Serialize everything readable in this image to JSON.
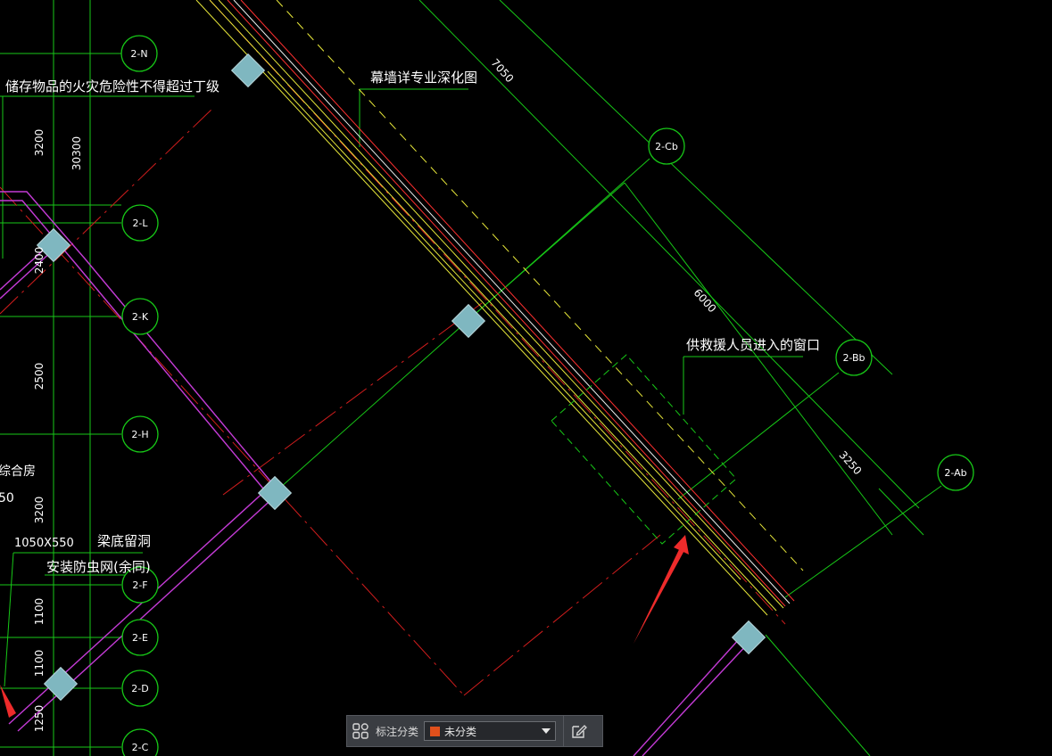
{
  "axes": [
    {
      "label": "2-N"
    },
    {
      "label": "2-L"
    },
    {
      "label": "2-K"
    },
    {
      "label": "2-H"
    },
    {
      "label": "2-F"
    },
    {
      "label": "2-E"
    },
    {
      "label": "2-D"
    },
    {
      "label": "2-C"
    },
    {
      "label": "2-Cb"
    },
    {
      "label": "2-Bb"
    },
    {
      "label": "2-Ab"
    }
  ],
  "dimensions_vertical": [
    "3200",
    "30300",
    "2400",
    "2500",
    "3200",
    "1100",
    "1100",
    "1250"
  ],
  "dimensions_diagonal": [
    "7050",
    "6000",
    "3250"
  ],
  "annotations": {
    "fire_rating": "储存物品的火灾危险性不得超过丁级",
    "curtain_wall": "幕墙详专业深化图",
    "rescue_window": "供救援人员进入的窗口",
    "room_partial": "综合房",
    "size_partial": "50",
    "opening_size": "1050X550",
    "opening_note": "梁底留洞",
    "opening_note2": "安装防虫网(余同)"
  },
  "toolbar": {
    "category_label": "标注分类",
    "category_value": "未分类",
    "category_color": "#e0501c"
  }
}
